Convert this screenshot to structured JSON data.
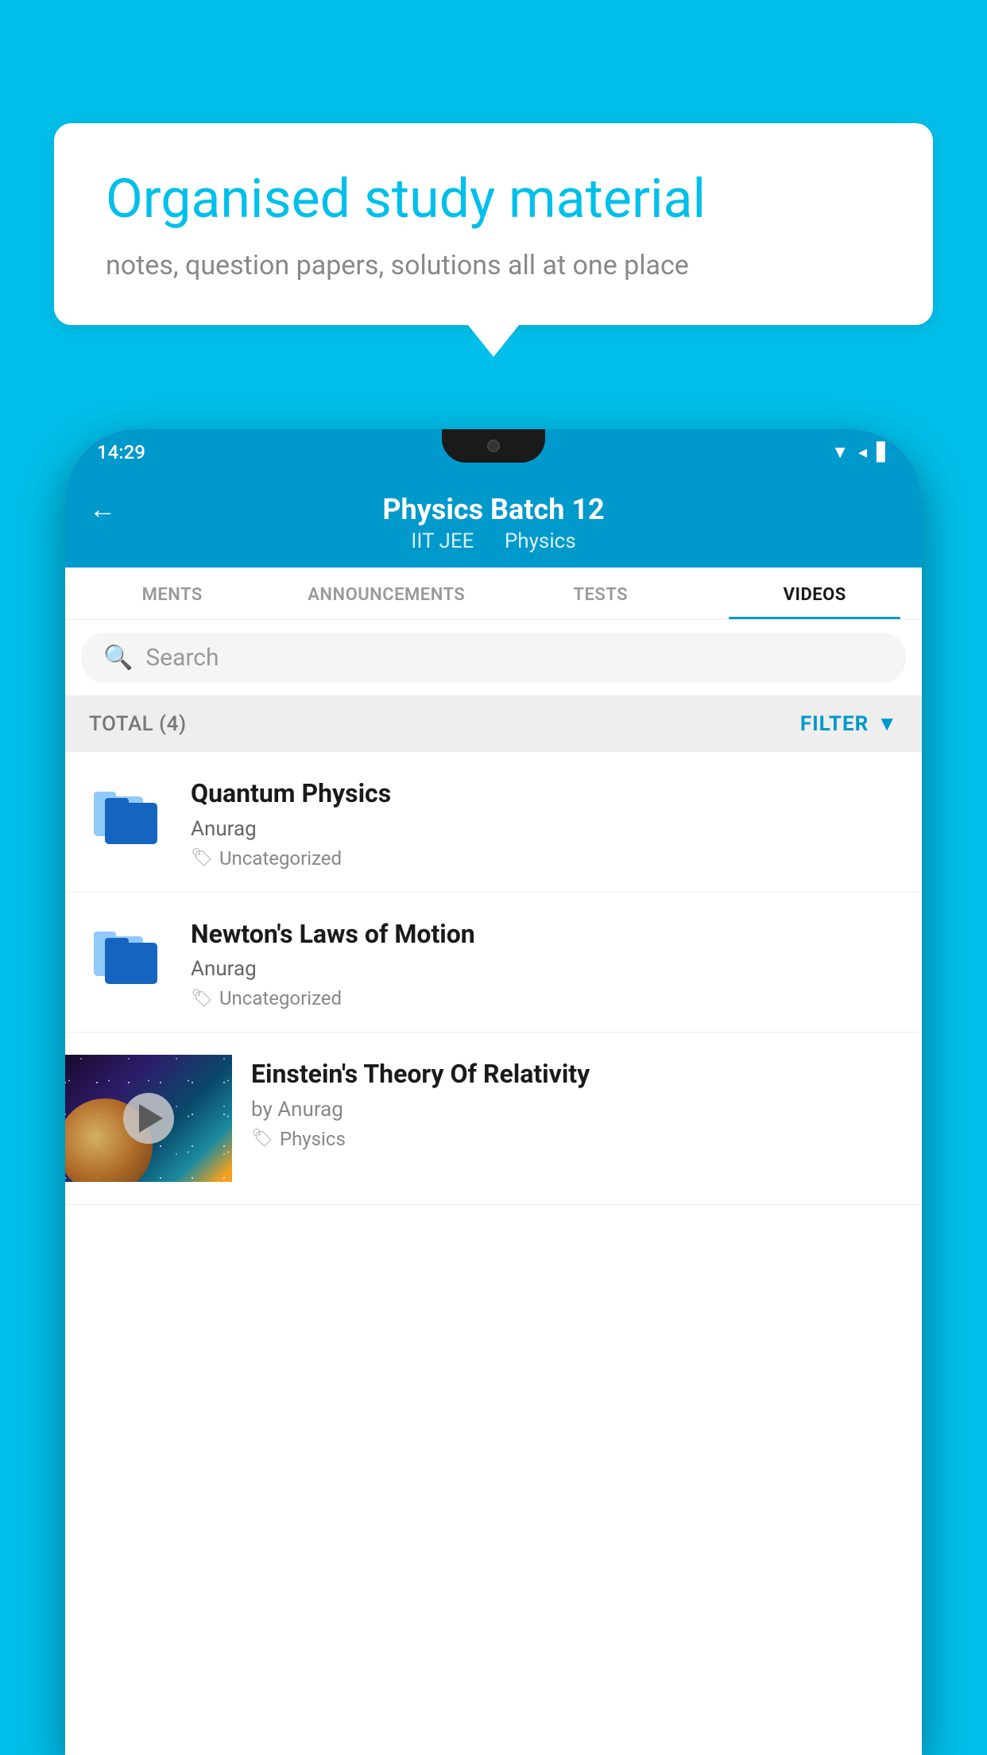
{
  "background_color": "#00BFEA",
  "bubble": {
    "title": "Organised study material",
    "subtitle": "notes, question papers, solutions all at one place"
  },
  "phone": {
    "status_bar": {
      "time": "14:29"
    },
    "header": {
      "title": "Physics Batch 12",
      "subtitle_part1": "IIT JEE",
      "subtitle_part2": "Physics",
      "back_label": "←"
    },
    "tabs": [
      {
        "label": "MENTS",
        "active": false
      },
      {
        "label": "ANNOUNCEMENTS",
        "active": false
      },
      {
        "label": "TESTS",
        "active": false
      },
      {
        "label": "VIDEOS",
        "active": true
      }
    ],
    "search": {
      "placeholder": "Search"
    },
    "filter_bar": {
      "total_label": "TOTAL (4)",
      "filter_label": "FILTER"
    },
    "videos": [
      {
        "title": "Quantum Physics",
        "author": "Anurag",
        "tag": "Uncategorized",
        "type": "folder"
      },
      {
        "title": "Newton's Laws of Motion",
        "author": "Anurag",
        "tag": "Uncategorized",
        "type": "folder"
      },
      {
        "title": "Einstein's Theory Of Relativity",
        "author": "by Anurag",
        "tag": "Physics",
        "type": "video"
      }
    ]
  }
}
